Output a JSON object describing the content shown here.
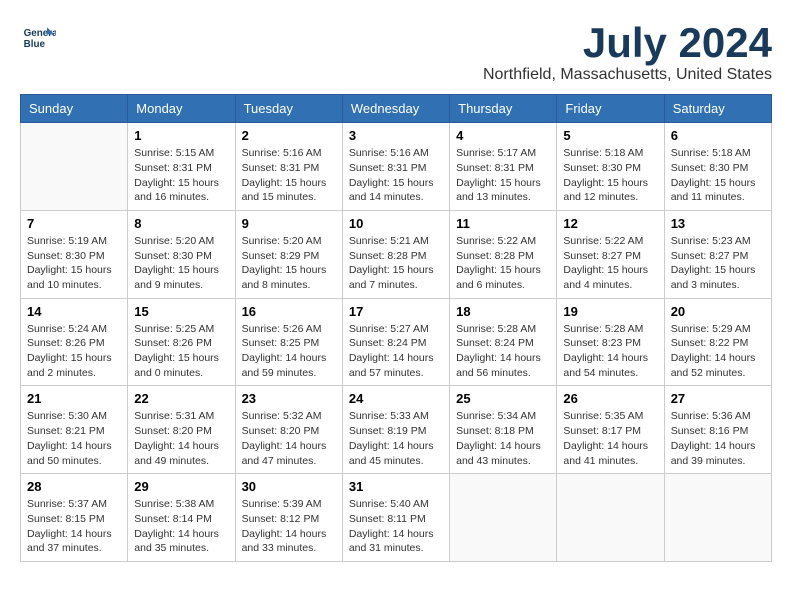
{
  "header": {
    "logo_line1": "General",
    "logo_line2": "Blue",
    "month_year": "July 2024",
    "location": "Northfield, Massachusetts, United States"
  },
  "weekdays": [
    "Sunday",
    "Monday",
    "Tuesday",
    "Wednesday",
    "Thursday",
    "Friday",
    "Saturday"
  ],
  "weeks": [
    [
      {
        "day": "",
        "info": ""
      },
      {
        "day": "1",
        "info": "Sunrise: 5:15 AM\nSunset: 8:31 PM\nDaylight: 15 hours\nand 16 minutes."
      },
      {
        "day": "2",
        "info": "Sunrise: 5:16 AM\nSunset: 8:31 PM\nDaylight: 15 hours\nand 15 minutes."
      },
      {
        "day": "3",
        "info": "Sunrise: 5:16 AM\nSunset: 8:31 PM\nDaylight: 15 hours\nand 14 minutes."
      },
      {
        "day": "4",
        "info": "Sunrise: 5:17 AM\nSunset: 8:31 PM\nDaylight: 15 hours\nand 13 minutes."
      },
      {
        "day": "5",
        "info": "Sunrise: 5:18 AM\nSunset: 8:30 PM\nDaylight: 15 hours\nand 12 minutes."
      },
      {
        "day": "6",
        "info": "Sunrise: 5:18 AM\nSunset: 8:30 PM\nDaylight: 15 hours\nand 11 minutes."
      }
    ],
    [
      {
        "day": "7",
        "info": "Sunrise: 5:19 AM\nSunset: 8:30 PM\nDaylight: 15 hours\nand 10 minutes."
      },
      {
        "day": "8",
        "info": "Sunrise: 5:20 AM\nSunset: 8:30 PM\nDaylight: 15 hours\nand 9 minutes."
      },
      {
        "day": "9",
        "info": "Sunrise: 5:20 AM\nSunset: 8:29 PM\nDaylight: 15 hours\nand 8 minutes."
      },
      {
        "day": "10",
        "info": "Sunrise: 5:21 AM\nSunset: 8:28 PM\nDaylight: 15 hours\nand 7 minutes."
      },
      {
        "day": "11",
        "info": "Sunrise: 5:22 AM\nSunset: 8:28 PM\nDaylight: 15 hours\nand 6 minutes."
      },
      {
        "day": "12",
        "info": "Sunrise: 5:22 AM\nSunset: 8:27 PM\nDaylight: 15 hours\nand 4 minutes."
      },
      {
        "day": "13",
        "info": "Sunrise: 5:23 AM\nSunset: 8:27 PM\nDaylight: 15 hours\nand 3 minutes."
      }
    ],
    [
      {
        "day": "14",
        "info": "Sunrise: 5:24 AM\nSunset: 8:26 PM\nDaylight: 15 hours\nand 2 minutes."
      },
      {
        "day": "15",
        "info": "Sunrise: 5:25 AM\nSunset: 8:26 PM\nDaylight: 15 hours\nand 0 minutes."
      },
      {
        "day": "16",
        "info": "Sunrise: 5:26 AM\nSunset: 8:25 PM\nDaylight: 14 hours\nand 59 minutes."
      },
      {
        "day": "17",
        "info": "Sunrise: 5:27 AM\nSunset: 8:24 PM\nDaylight: 14 hours\nand 57 minutes."
      },
      {
        "day": "18",
        "info": "Sunrise: 5:28 AM\nSunset: 8:24 PM\nDaylight: 14 hours\nand 56 minutes."
      },
      {
        "day": "19",
        "info": "Sunrise: 5:28 AM\nSunset: 8:23 PM\nDaylight: 14 hours\nand 54 minutes."
      },
      {
        "day": "20",
        "info": "Sunrise: 5:29 AM\nSunset: 8:22 PM\nDaylight: 14 hours\nand 52 minutes."
      }
    ],
    [
      {
        "day": "21",
        "info": "Sunrise: 5:30 AM\nSunset: 8:21 PM\nDaylight: 14 hours\nand 50 minutes."
      },
      {
        "day": "22",
        "info": "Sunrise: 5:31 AM\nSunset: 8:20 PM\nDaylight: 14 hours\nand 49 minutes."
      },
      {
        "day": "23",
        "info": "Sunrise: 5:32 AM\nSunset: 8:20 PM\nDaylight: 14 hours\nand 47 minutes."
      },
      {
        "day": "24",
        "info": "Sunrise: 5:33 AM\nSunset: 8:19 PM\nDaylight: 14 hours\nand 45 minutes."
      },
      {
        "day": "25",
        "info": "Sunrise: 5:34 AM\nSunset: 8:18 PM\nDaylight: 14 hours\nand 43 minutes."
      },
      {
        "day": "26",
        "info": "Sunrise: 5:35 AM\nSunset: 8:17 PM\nDaylight: 14 hours\nand 41 minutes."
      },
      {
        "day": "27",
        "info": "Sunrise: 5:36 AM\nSunset: 8:16 PM\nDaylight: 14 hours\nand 39 minutes."
      }
    ],
    [
      {
        "day": "28",
        "info": "Sunrise: 5:37 AM\nSunset: 8:15 PM\nDaylight: 14 hours\nand 37 minutes."
      },
      {
        "day": "29",
        "info": "Sunrise: 5:38 AM\nSunset: 8:14 PM\nDaylight: 14 hours\nand 35 minutes."
      },
      {
        "day": "30",
        "info": "Sunrise: 5:39 AM\nSunset: 8:12 PM\nDaylight: 14 hours\nand 33 minutes."
      },
      {
        "day": "31",
        "info": "Sunrise: 5:40 AM\nSunset: 8:11 PM\nDaylight: 14 hours\nand 31 minutes."
      },
      {
        "day": "",
        "info": ""
      },
      {
        "day": "",
        "info": ""
      },
      {
        "day": "",
        "info": ""
      }
    ]
  ]
}
